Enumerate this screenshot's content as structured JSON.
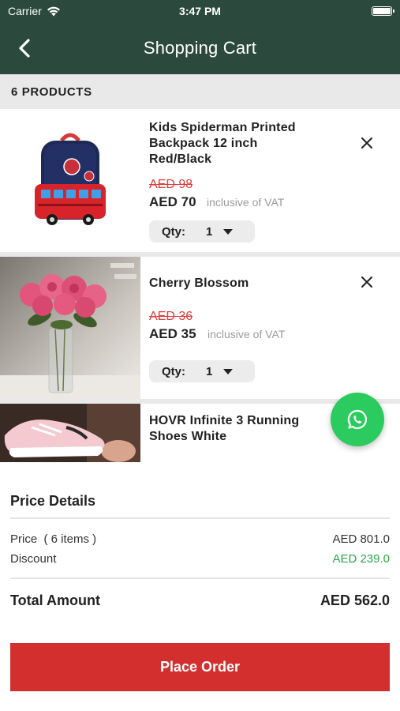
{
  "status_bar": {
    "carrier": "Carrier",
    "time": "3:47 PM"
  },
  "nav": {
    "title": "Shopping Cart",
    "back_icon": "chevron-left-icon"
  },
  "products_header": {
    "label": "6 PRODUCTS"
  },
  "cart_items": [
    {
      "name": "Kids Spiderman Printed Backpack 12 inch Red/Black",
      "old_price": "AED 98",
      "price": "AED 70",
      "vat_note": "inclusive of VAT",
      "qty_label": "Qty:",
      "qty_value": "1"
    },
    {
      "name": "Cherry Blossom",
      "old_price": "AED 36",
      "price": "AED 35",
      "vat_note": "inclusive of VAT",
      "qty_label": "Qty:",
      "qty_value": "1"
    },
    {
      "name": "HOVR Infinite 3 Running Shoes White"
    }
  ],
  "price_details": {
    "title": "Price Details",
    "price_label": "Price  ( 6 items )",
    "price_value": "AED 801.0",
    "discount_label": "Discount",
    "discount_value": "AED 239.0",
    "total_label": "Total Amount",
    "total_value": "AED 562.0"
  },
  "actions": {
    "place_order": "Place Order"
  },
  "colors": {
    "nav_bg": "#2b4a3d",
    "old_price": "#e03c3c",
    "discount": "#2aa84a",
    "place_order_bg": "#d32f2f",
    "whatsapp": "#2bcb5f"
  }
}
